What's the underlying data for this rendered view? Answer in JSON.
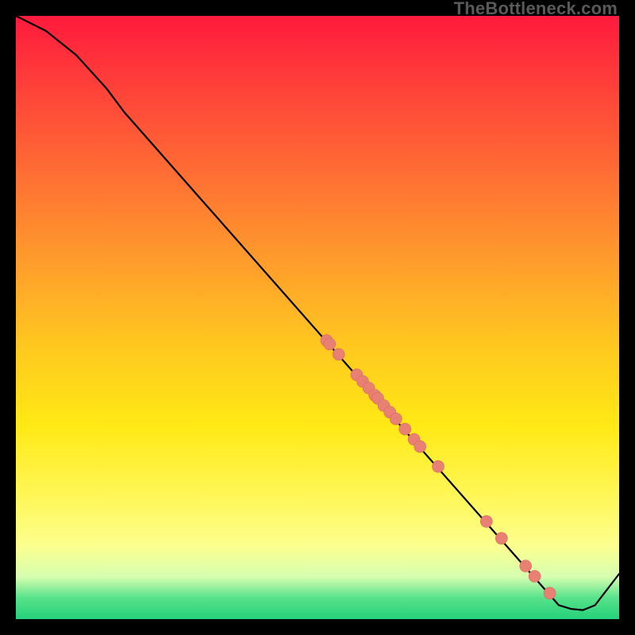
{
  "watermark": "TheBottleneck.com",
  "colors": {
    "point_fill": "#e88074",
    "point_stroke": "#d86a5e",
    "line": "#000000",
    "frame": "#000000"
  },
  "chart_data": {
    "type": "line",
    "title": "",
    "xlabel": "",
    "ylabel": "",
    "xlim": [
      0,
      100
    ],
    "ylim": [
      0,
      100
    ],
    "grid": false,
    "legend": false,
    "line_path_xy": [
      [
        0,
        100
      ],
      [
        5,
        97.5
      ],
      [
        10,
        93.5
      ],
      [
        15,
        88.0
      ],
      [
        18,
        84.0
      ],
      [
        90,
        2.3
      ],
      [
        92,
        1.7
      ],
      [
        94,
        1.5
      ],
      [
        96,
        2.3
      ],
      [
        100,
        7.5
      ]
    ],
    "marker_radius": 7.5,
    "points_xy": [
      [
        51.5,
        46.2
      ],
      [
        52.0,
        45.6
      ],
      [
        53.5,
        43.9
      ],
      [
        56.5,
        40.5
      ],
      [
        57.5,
        39.4
      ],
      [
        58.5,
        38.3
      ],
      [
        59.5,
        37.1
      ],
      [
        60.0,
        36.6
      ],
      [
        61.0,
        35.4
      ],
      [
        62.0,
        34.3
      ],
      [
        63.0,
        33.2
      ],
      [
        64.5,
        31.5
      ],
      [
        66.0,
        29.8
      ],
      [
        67.0,
        28.6
      ],
      [
        70.0,
        25.3
      ],
      [
        78.0,
        16.2
      ],
      [
        80.5,
        13.4
      ],
      [
        84.5,
        8.8
      ],
      [
        86.0,
        7.1
      ],
      [
        88.5,
        4.3
      ]
    ]
  }
}
